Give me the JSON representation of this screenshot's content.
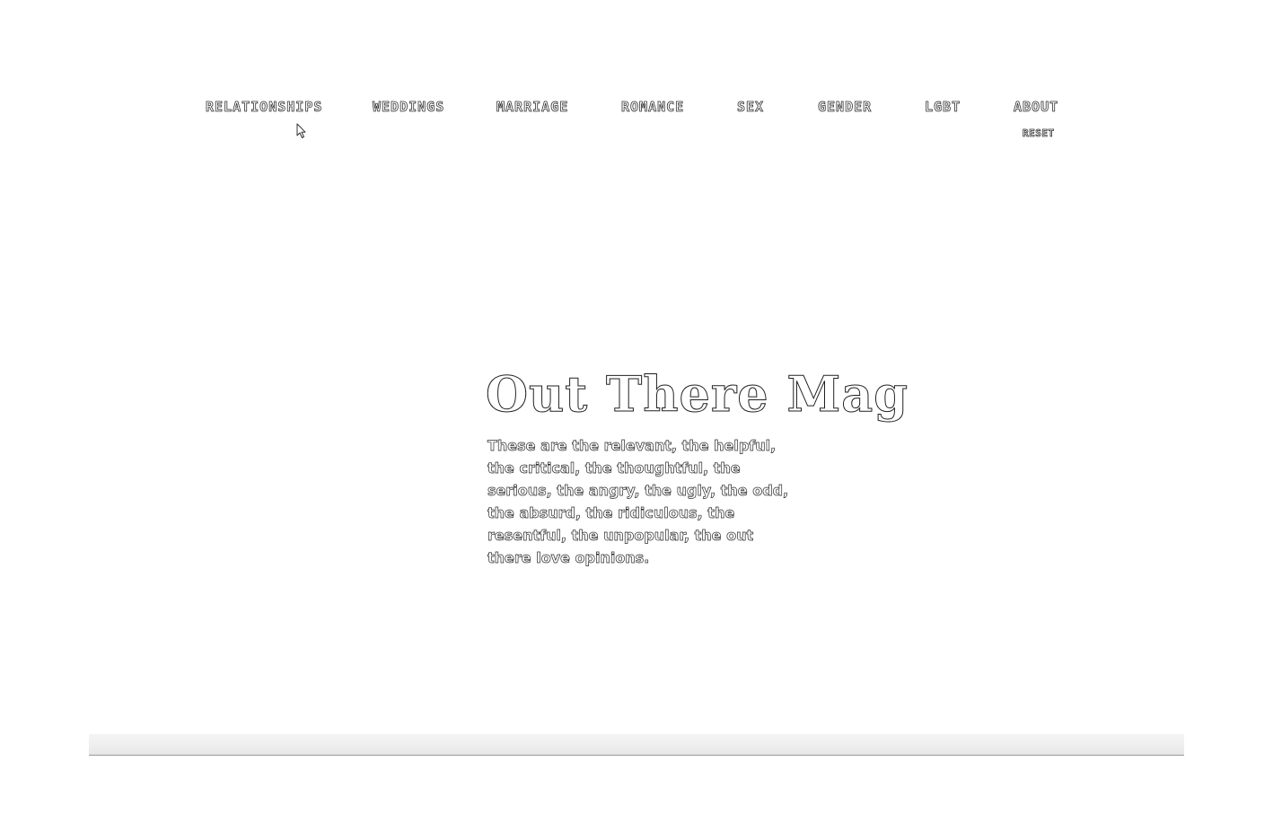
{
  "nav": {
    "items": [
      {
        "label": "RELATIONSHIPS"
      },
      {
        "label": "WEDDINGS"
      },
      {
        "label": "MARRIAGE"
      },
      {
        "label": "ROMANCE"
      },
      {
        "label": "SEX"
      },
      {
        "label": "GENDER"
      },
      {
        "label": "LGBT"
      },
      {
        "label": "ABOUT"
      }
    ],
    "reset_label": "RESET"
  },
  "hero": {
    "title": "Out There Mag",
    "tagline": "These are the relevant, the helpful, the critical, the thoughtful, the serious, the angry, the ugly, the odd, the absurd, the ridiculous, the resentful, the unpopular, the out there love opinions."
  },
  "colors": {
    "background": "#ffffff",
    "outline": "#2a2a2a",
    "bottom_bar": "#eeeeee"
  },
  "icons": {
    "cursor": "mouse-pointer-icon"
  }
}
